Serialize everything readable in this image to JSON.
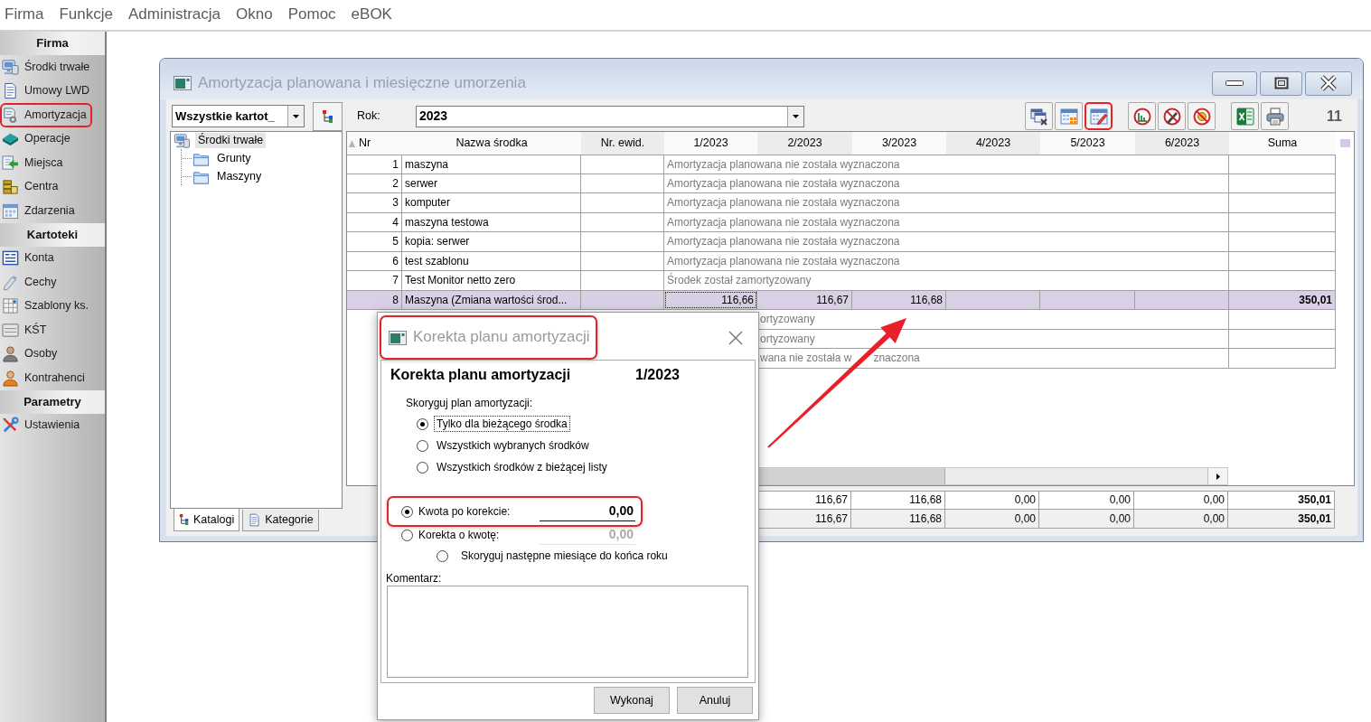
{
  "menu": [
    "Firma",
    "Funkcje",
    "Administracja",
    "Okno",
    "Pomoc",
    "eBOK"
  ],
  "sidebar": {
    "sections": [
      {
        "title": "Firma",
        "items": [
          {
            "label": "Środki trwałe",
            "highlighted": false
          },
          {
            "label": "Umowy LWD",
            "highlighted": false
          },
          {
            "label": "Amortyzacja",
            "highlighted": true
          },
          {
            "label": "Operacje",
            "highlighted": false
          },
          {
            "label": "Miejsca",
            "highlighted": false
          },
          {
            "label": "Centra",
            "highlighted": false
          },
          {
            "label": "Zdarzenia",
            "highlighted": false
          }
        ]
      },
      {
        "title": "Kartoteki",
        "items": [
          {
            "label": "Konta",
            "highlighted": false
          },
          {
            "label": "Cechy",
            "highlighted": false
          },
          {
            "label": "Szablony ks.",
            "highlighted": false
          },
          {
            "label": "KŚT",
            "highlighted": false
          },
          {
            "label": "Osoby",
            "highlighted": false
          },
          {
            "label": "Kontrahenci",
            "highlighted": false
          }
        ]
      },
      {
        "title": "Parametry",
        "items": [
          {
            "label": "Ustawienia",
            "highlighted": false
          }
        ]
      }
    ]
  },
  "window": {
    "title": "Amortyzacja planowana i miesięczne umorzenia",
    "filter": {
      "value": "Wszystkie kartot_"
    },
    "tree": [
      {
        "label": "Środki trwałe",
        "selected": true,
        "children": [
          {
            "label": "Grunty",
            "selected": false
          },
          {
            "label": "Maszyny",
            "selected": false
          }
        ]
      }
    ],
    "tabs": [
      {
        "label": "Katalogi",
        "selected": true
      },
      {
        "label": "Kategorie",
        "selected": false
      }
    ],
    "year": {
      "label": "Rok:",
      "value": "2023"
    },
    "toolbar": {
      "groups": [
        {
          "buttons": [
            {
              "highlighted": false
            },
            {
              "highlighted": false
            },
            {
              "highlighted": true
            }
          ]
        },
        {
          "buttons": [
            {
              "highlighted": false
            },
            {
              "highlighted": false
            },
            {
              "highlighted": false
            }
          ]
        },
        {
          "buttons": [
            {
              "highlighted": false
            },
            {
              "highlighted": false
            }
          ]
        }
      ]
    },
    "record_count": "11",
    "table": {
      "columns": [
        {
          "label": "Nr",
          "sorted": true
        },
        {
          "label": "Nazwa środka",
          "sorted": false
        },
        {
          "label": "Nr. ewid.",
          "sorted": false
        },
        {
          "label": "1/2023",
          "sorted": false
        },
        {
          "label": "2/2023",
          "sorted": false
        },
        {
          "label": "3/2023",
          "sorted": false
        },
        {
          "label": "4/2023",
          "sorted": false
        },
        {
          "label": "5/2023",
          "sorted": false
        },
        {
          "label": "6/2023",
          "sorted": false
        },
        {
          "label": "Suma",
          "sorted": false
        }
      ],
      "rows": [
        {
          "kind": "note",
          "nr": "1",
          "name": "maszyna",
          "note": "Amortyzacja planowana nie została wyznaczona",
          "selected": false
        },
        {
          "kind": "note",
          "nr": "2",
          "name": "serwer",
          "note": "Amortyzacja planowana nie została wyznaczona",
          "selected": false
        },
        {
          "kind": "note",
          "nr": "3",
          "name": "komputer",
          "note": "Amortyzacja planowana nie została wyznaczona",
          "selected": false
        },
        {
          "kind": "note",
          "nr": "4",
          "name": "maszyna testowa",
          "note": "Amortyzacja planowana nie została wyznaczona",
          "selected": false
        },
        {
          "kind": "note",
          "nr": "5",
          "name": "kopia: serwer",
          "note": "Amortyzacja planowana nie została wyznaczona",
          "selected": false
        },
        {
          "kind": "note",
          "nr": "6",
          "name": "test szablonu",
          "note": "Amortyzacja planowana nie została wyznaczona",
          "selected": false
        },
        {
          "kind": "note",
          "nr": "7",
          "name": "Test Monitor netto zero",
          "note": "Środek został zamortyzowany",
          "selected": false
        },
        {
          "kind": "amounts",
          "nr": "8",
          "name": "Maszyna (Zmiana wartości środ...",
          "months": [
            {
              "value": "116,66",
              "focused": true
            },
            {
              "value": "116,67",
              "focused": false
            },
            {
              "value": "116,68",
              "focused": false
            }
          ],
          "sum": "350,01",
          "selected": true
        },
        {
          "kind": "clipped_note",
          "note_parts": [
            "ortyzowany"
          ],
          "selected": false
        },
        {
          "kind": "clipped_note",
          "note_parts": [
            "ortyzowany"
          ],
          "selected": false
        },
        {
          "kind": "clipped_note",
          "note_parts": [
            "wana nie została w",
            "znaczona"
          ],
          "selected": false
        }
      ],
      "totals": [
        {
          "months": [
            "116,67",
            "116,68",
            "0,00",
            "0,00",
            "0,00"
          ],
          "sum": "350,01"
        },
        {
          "months": [
            "116,67",
            "116,68",
            "0,00",
            "0,00",
            "0,00"
          ],
          "sum": "350,01"
        }
      ]
    }
  },
  "dialog": {
    "title": "Korekta planu amortyzacji",
    "title_highlighted": true,
    "heading": "Korekta planu amortyzacji",
    "period": "1/2023",
    "scope_label": "Skoryguj plan amortyzacji:",
    "scope_options": [
      {
        "label": "Tylko dla bieżącego środka",
        "selected": true,
        "focused": true
      },
      {
        "label": "Wszystkich wybranych środków",
        "selected": false,
        "focused": false
      },
      {
        "label": "Wszystkich środków z bieżącej listy",
        "selected": false,
        "focused": false
      }
    ],
    "modes": [
      {
        "label": "Kwota po korekcie:",
        "selected": true,
        "value": "0,00",
        "disabled": false,
        "highlighted": true
      },
      {
        "label": "Korekta o kwotę:",
        "selected": false,
        "value": "0,00",
        "disabled": true,
        "highlighted": false
      }
    ],
    "next_months": {
      "label": "Skoryguj następne miesiące do końca roku",
      "selected": false
    },
    "comment_label": "Komentarz:",
    "buttons": [
      "Wykonaj",
      "Anuluj"
    ]
  },
  "annotation_arrow": true
}
